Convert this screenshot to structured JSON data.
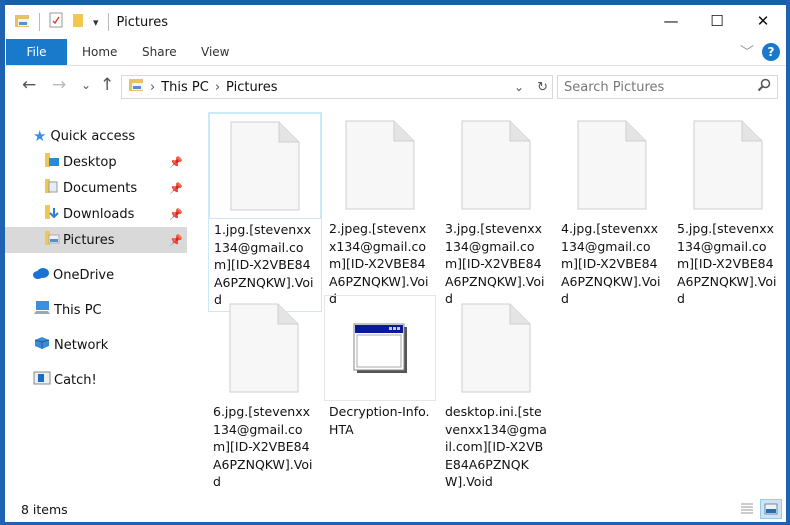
{
  "window": {
    "title": "Pictures",
    "controls": {
      "minimize": "—",
      "maximize": "☐",
      "close": "✕"
    }
  },
  "quick_access_toolbar": {
    "dropdown": "▾"
  },
  "ribbon": {
    "tabs": [
      {
        "label": "File"
      },
      {
        "label": "Home"
      },
      {
        "label": "Share"
      },
      {
        "label": "View"
      }
    ],
    "help": "?",
    "collapse": "﹀"
  },
  "nav": {
    "back": "←",
    "forward": "→",
    "recent": "⌄",
    "up": "↑",
    "breadcrumb": [
      "This PC",
      "Pictures"
    ],
    "separator": "›",
    "refresh": "↻",
    "dropdown": "⌄",
    "search_placeholder": "Search Pictures"
  },
  "sidebar": {
    "items": [
      {
        "label": "Quick access",
        "icon": "star-icon"
      },
      {
        "label": "Desktop",
        "icon": "desktop-folder-icon",
        "pinned": true
      },
      {
        "label": "Documents",
        "icon": "documents-folder-icon",
        "pinned": true
      },
      {
        "label": "Downloads",
        "icon": "downloads-folder-icon",
        "pinned": true
      },
      {
        "label": "Pictures",
        "icon": "pictures-folder-icon",
        "pinned": true,
        "selected": true
      },
      {
        "label": "OneDrive",
        "icon": "cloud-icon"
      },
      {
        "label": "This PC",
        "icon": "computer-icon"
      },
      {
        "label": "Network",
        "icon": "network-icon"
      },
      {
        "label": "Catch!",
        "icon": "app-icon"
      }
    ]
  },
  "files": [
    {
      "name": "1.jpg.[stevenxx134@gmail.com][ID-X2VBE84A6PZNQKW].Void",
      "icon": "blank-file-icon"
    },
    {
      "name": "2.jpeg.[stevenxx134@gmail.com][ID-X2VBE84A6PZNQKW].Void",
      "icon": "blank-file-icon"
    },
    {
      "name": "3.jpg.[stevenxx134@gmail.com][ID-X2VBE84A6PZNQKW].Void",
      "icon": "blank-file-icon"
    },
    {
      "name": "4.jpg.[stevenxx134@gmail.com][ID-X2VBE84A6PZNQKW].Void",
      "icon": "blank-file-icon"
    },
    {
      "name": "5.jpg.[stevenxx134@gmail.com][ID-X2VBE84A6PZNQKW].Void",
      "icon": "blank-file-icon"
    },
    {
      "name": "6.jpg.[stevenxx134@gmail.com][ID-X2VBE84A6PZNQKW].Void",
      "icon": "blank-file-icon"
    },
    {
      "name": "Decryption-Info.HTA",
      "icon": "hta-window-icon"
    },
    {
      "name": "desktop.ini.[stevenxx134@gmail.com][ID-X2VBE84A6PZNQKW].Void",
      "icon": "blank-file-icon"
    }
  ],
  "status": {
    "item_count": "8 items"
  },
  "colors": {
    "accent": "#1979ca",
    "frame": "#1e63b0",
    "selected": "#d9d9d9"
  }
}
